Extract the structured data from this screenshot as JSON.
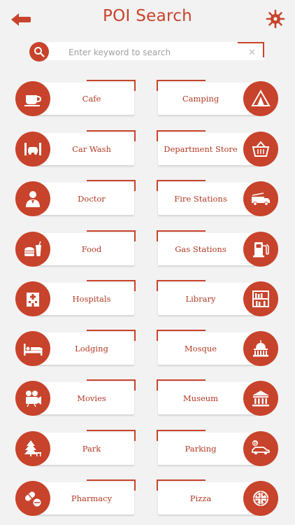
{
  "header": {
    "title": "POI Search"
  },
  "search": {
    "placeholder": "Enter keyword to search",
    "clear": "✕"
  },
  "categories": [
    {
      "label": "Cafe",
      "icon": "coffee-cup-icon"
    },
    {
      "label": "Camping",
      "icon": "tent-icon"
    },
    {
      "label": "Car Wash",
      "icon": "car-wash-icon"
    },
    {
      "label": "Department Store",
      "icon": "shopping-basket-icon"
    },
    {
      "label": "Doctor",
      "icon": "doctor-icon"
    },
    {
      "label": "Fire Stations",
      "icon": "fire-truck-icon"
    },
    {
      "label": "Food",
      "icon": "burger-drink-icon"
    },
    {
      "label": "Gas Stations",
      "icon": "fuel-pump-icon"
    },
    {
      "label": "Hospitals",
      "icon": "hospital-building-icon"
    },
    {
      "label": "Library",
      "icon": "bookshelf-icon"
    },
    {
      "label": "Lodging",
      "icon": "bed-icon"
    },
    {
      "label": "Mosque",
      "icon": "dome-building-icon"
    },
    {
      "label": "Movies",
      "icon": "film-projector-icon"
    },
    {
      "label": "Museum",
      "icon": "museum-icon"
    },
    {
      "label": "Park",
      "icon": "tree-bench-icon"
    },
    {
      "label": "Parking",
      "icon": "parking-car-icon"
    },
    {
      "label": "Pharmacy",
      "icon": "pill-capsule-icon"
    },
    {
      "label": "Pizza",
      "icon": "pizza-icon"
    }
  ],
  "colors": {
    "accent": "#c8432b",
    "background": "#f2f2f2",
    "card": "#ffffff",
    "label": "#b23a24"
  }
}
